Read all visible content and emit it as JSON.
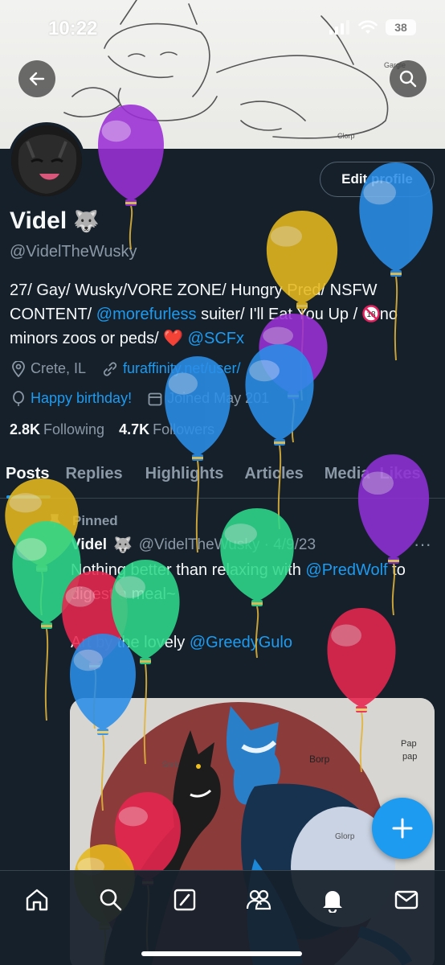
{
  "status_bar": {
    "time": "10:22",
    "battery": "38"
  },
  "profile": {
    "edit_button": "Edit profile",
    "name": "Videl",
    "name_emoji": "🐺",
    "handle": "@VidelTheWusky",
    "bio_line1": "27/ Gay/ Wusky/VORE ZONE/ Hungry Pred/ NSFW",
    "bio_line2_pre": "CONTENT/ ",
    "bio_line2_link": "@morefurless",
    "bio_line2_post": " suiter/ I'll Eat You Up / ",
    "bio_line2_tail": "no",
    "bio_line3_pre": "minors zoos or peds/ ",
    "bio_line3_heart": "❤️",
    "bio_line3_link": "@SCFx",
    "location": "Crete, IL",
    "website": "furaffinity.net/user/",
    "birthday": "Happy birthday!",
    "joined": "Joined May 201",
    "following_count": "2.8K",
    "following_label": "Following",
    "followers_count": "4.7K",
    "followers_label": "Followers"
  },
  "tabs": [
    "Posts",
    "Replies",
    "Highlights",
    "Articles",
    "Media",
    "Likes"
  ],
  "pinned_post": {
    "pinned_label": "Pinned",
    "author": "Videl",
    "author_emoji": "🐺",
    "handle_date": "@VidelTheWusky · 4/9/23",
    "more": "···",
    "text_pre": "Nothing better than relaxing with ",
    "mention1": "@PredWolf",
    "text_mid": " to digest a meal~",
    "text_line3_pre": "Art by the lovely ",
    "mention2": "@GreedyGulo"
  },
  "image_text": {
    "borp": "Borp",
    "pap1": "Pap",
    "pap2": "pap",
    "snrk": "Snrk",
    "glorp": "Glorp",
    "gargle": "Gargle",
    "clorp": "Clorp"
  },
  "icons": {
    "back": "arrow-left-icon",
    "search": "search-icon",
    "location": "location-pin-icon",
    "link": "link-icon",
    "birthday": "balloon-icon",
    "calendar": "calendar-icon",
    "pin": "pin-icon",
    "compose": "plus-icon"
  },
  "colors": {
    "background": "#15202b",
    "accent": "#1d9bf0",
    "muted": "#8b98a5",
    "border": "#38444d"
  },
  "balloons": [
    {
      "color": "#9b2fd6"
    },
    {
      "color": "#2b8ee8"
    },
    {
      "color": "#e6b91e"
    },
    {
      "color": "#9b2fd6"
    },
    {
      "color": "#2b8ee8"
    },
    {
      "color": "#2b8ee8"
    },
    {
      "color": "#e6b91e"
    },
    {
      "color": "#2ed98a"
    },
    {
      "color": "#2ed98a"
    },
    {
      "color": "#e8264f"
    },
    {
      "color": "#2ed98a"
    },
    {
      "color": "#2b8ee8"
    },
    {
      "color": "#8f2fd6"
    },
    {
      "color": "#e8264f"
    },
    {
      "color": "#e8264f"
    },
    {
      "color": "#e6b91e"
    }
  ]
}
